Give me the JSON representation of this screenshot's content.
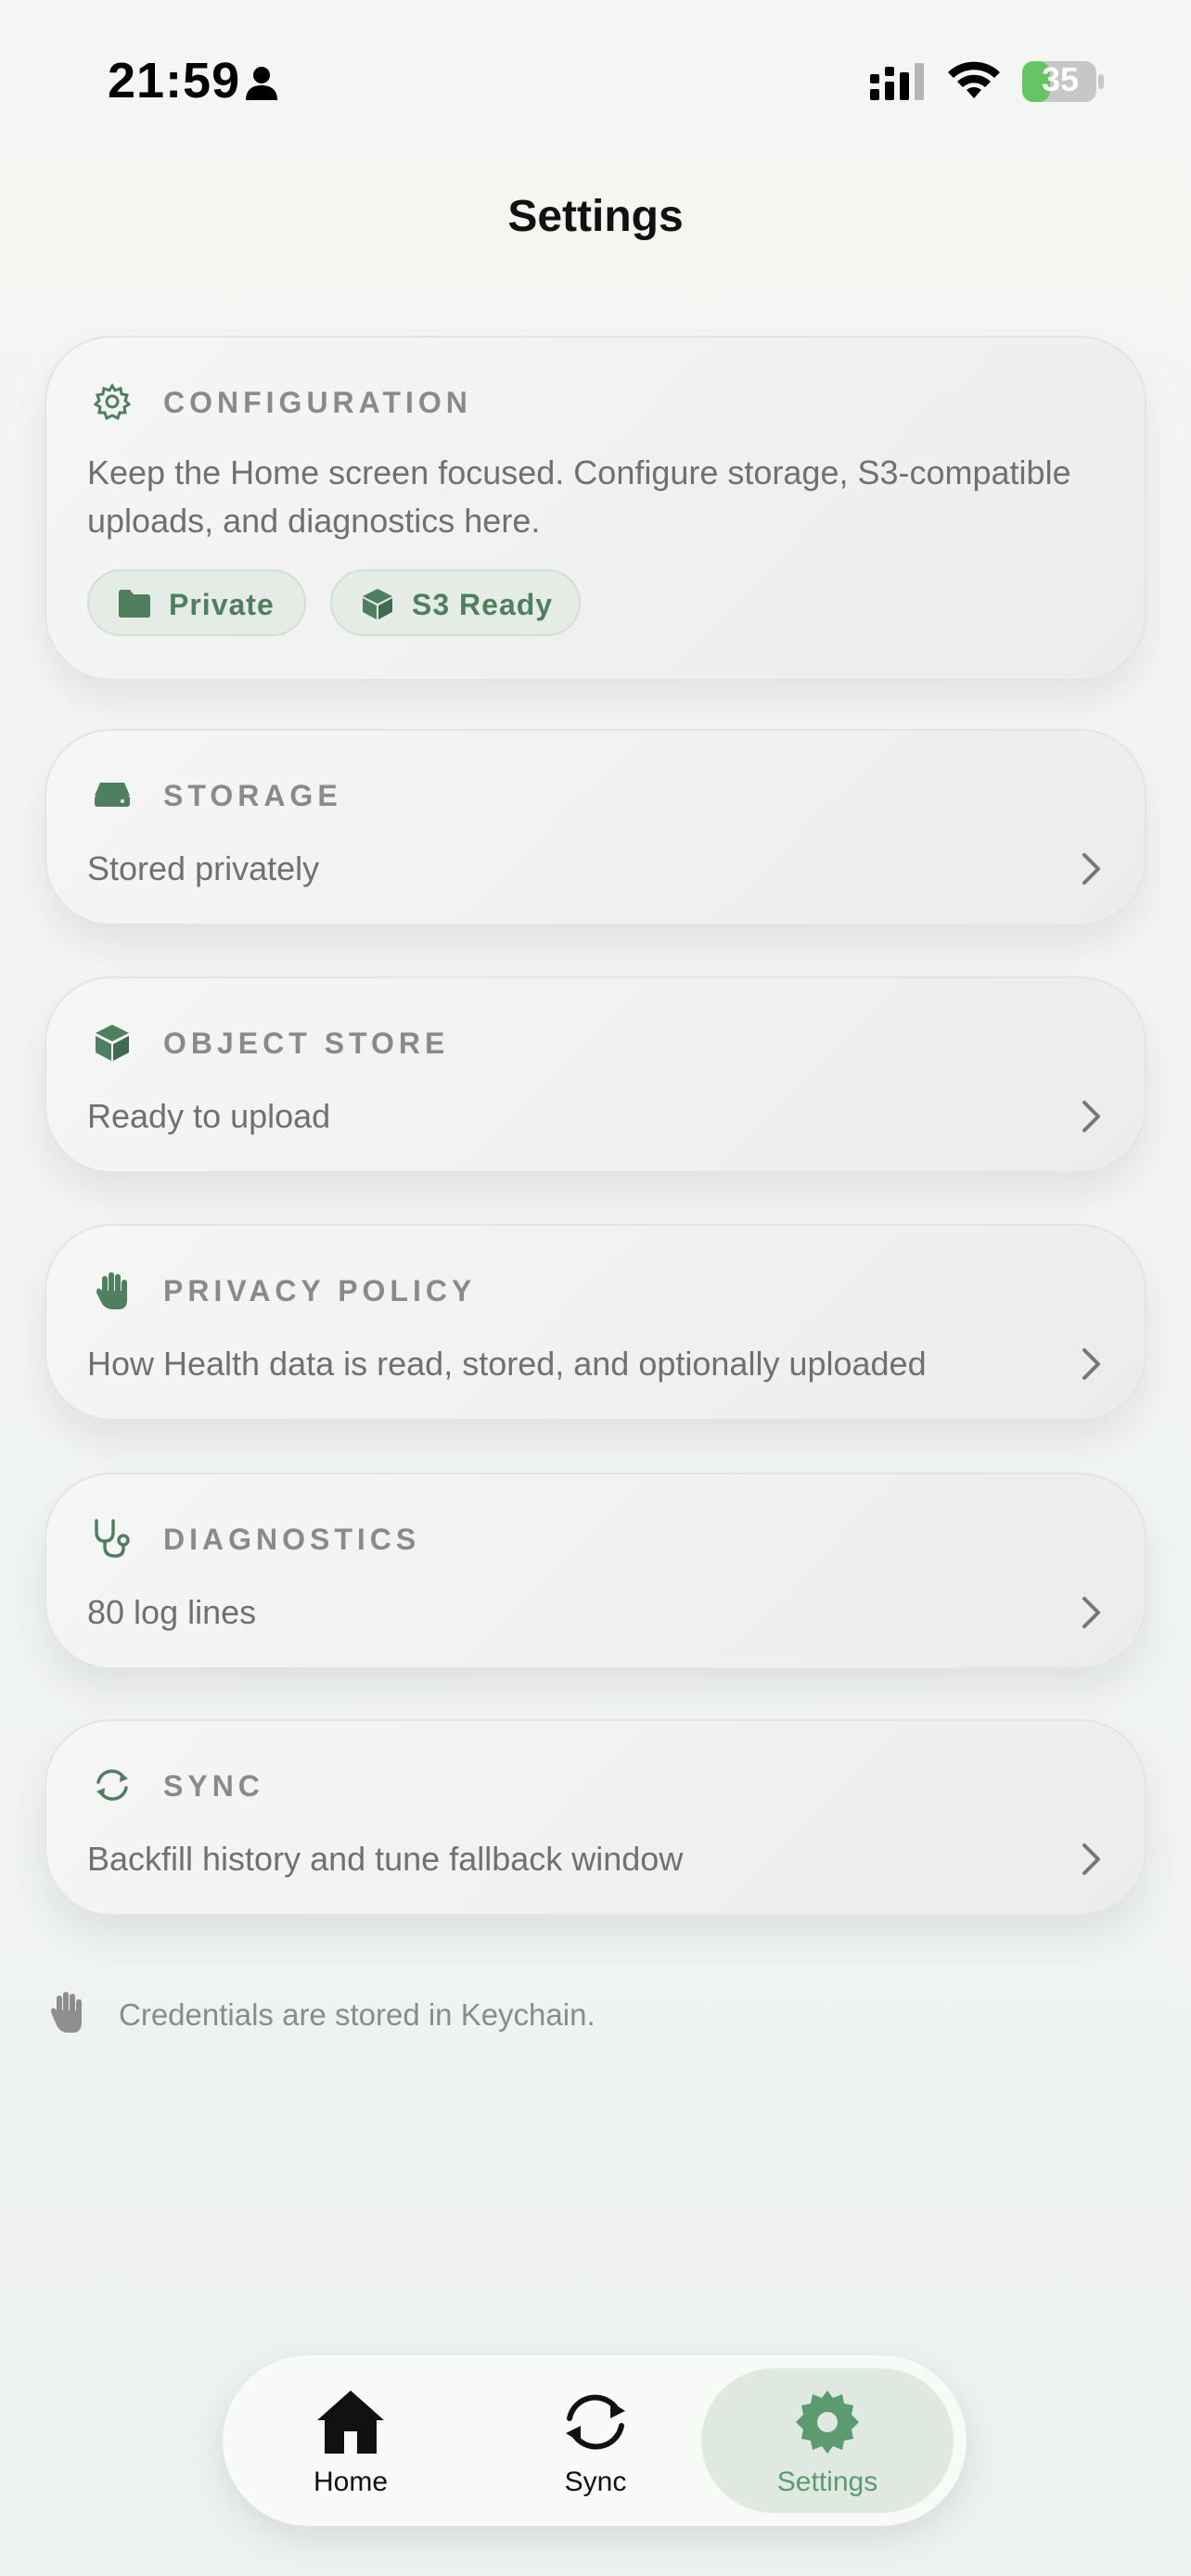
{
  "status_bar": {
    "time": "21:59",
    "battery": "35",
    "icons": [
      "person-icon",
      "cellular-signal-icon",
      "wifi-icon",
      "battery-charging-icon"
    ]
  },
  "page": {
    "title": "Settings"
  },
  "configuration": {
    "heading": "CONFIGURATION",
    "description": "Keep the Home screen focused. Configure storage, S3-compatible uploads, and diagnostics here.",
    "icon": "gear-icon",
    "chips": [
      {
        "label": "Private",
        "icon": "folder-icon"
      },
      {
        "label": "S3 Ready",
        "icon": "cube-icon"
      }
    ]
  },
  "cards": [
    {
      "heading": "STORAGE",
      "subtitle": "Stored privately",
      "icon": "drive-icon"
    },
    {
      "heading": "OBJECT STORE",
      "subtitle": "Ready to upload",
      "icon": "cube-icon"
    },
    {
      "heading": "PRIVACY POLICY",
      "subtitle": "How Health data is read, stored, and optionally uploaded",
      "icon": "hand-icon"
    },
    {
      "heading": "DIAGNOSTICS",
      "subtitle": "80 log lines",
      "icon": "stethoscope-icon"
    },
    {
      "heading": "SYNC",
      "subtitle": "Backfill history and tune fallback window",
      "icon": "sync-icon"
    }
  ],
  "footer": {
    "note": "Credentials are stored in Keychain.",
    "icon": "hand-icon"
  },
  "tab_bar": {
    "tabs": [
      {
        "label": "Home",
        "icon": "home-icon",
        "active": false
      },
      {
        "label": "Sync",
        "icon": "sync-icon",
        "active": false
      },
      {
        "label": "Settings",
        "icon": "gear-icon",
        "active": true
      }
    ]
  },
  "colors": {
    "accent": "#4e8060",
    "accent_active_tab": "#5c9a70",
    "chip_background": "#e4ece5",
    "muted_text": "#707070",
    "heading_text": "#8a8a8a",
    "battery_green": "#65c466"
  }
}
